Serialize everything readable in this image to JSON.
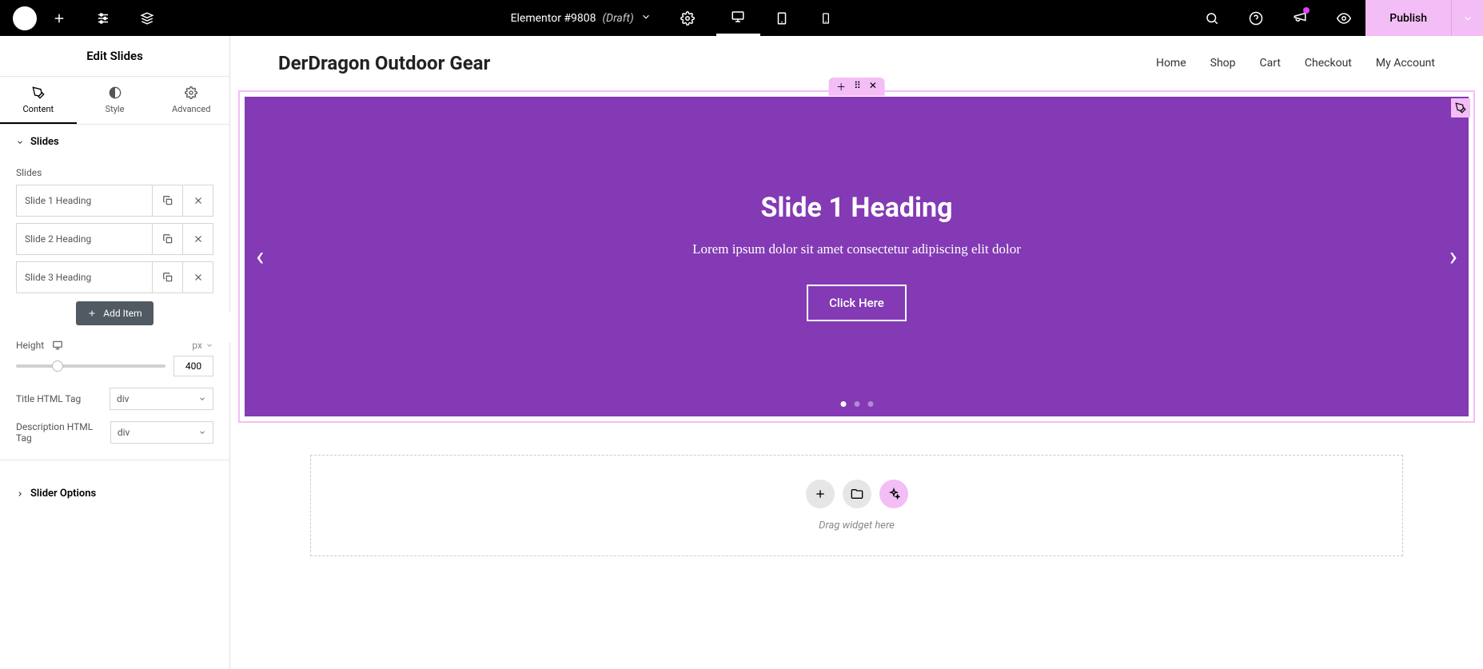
{
  "topbar": {
    "title": "Elementor #9808",
    "status": "(Draft)",
    "publish": "Publish"
  },
  "sidebar": {
    "title": "Edit Slides",
    "tabs": {
      "content": "Content",
      "style": "Style",
      "advanced": "Advanced"
    },
    "section_slides": "Slides",
    "slides_label": "Slides",
    "items": [
      {
        "label": "Slide 1 Heading"
      },
      {
        "label": "Slide 2 Heading"
      },
      {
        "label": "Slide 3 Heading"
      }
    ],
    "add_item": "Add Item",
    "height_label": "Height",
    "height_unit": "px",
    "height_value": "400",
    "title_tag_label": "Title HTML Tag",
    "title_tag_value": "div",
    "desc_tag_label": "Description HTML Tag",
    "desc_tag_value": "div",
    "section_options": "Slider Options"
  },
  "site": {
    "title": "DerDragon Outdoor Gear",
    "nav": [
      "Home",
      "Shop",
      "Cart",
      "Checkout",
      "My Account"
    ]
  },
  "slide": {
    "heading": "Slide 1 Heading",
    "desc": "Lorem ipsum dolor sit amet consectetur adipiscing elit dolor",
    "button": "Click Here"
  },
  "dropzone": {
    "text": "Drag widget here"
  }
}
